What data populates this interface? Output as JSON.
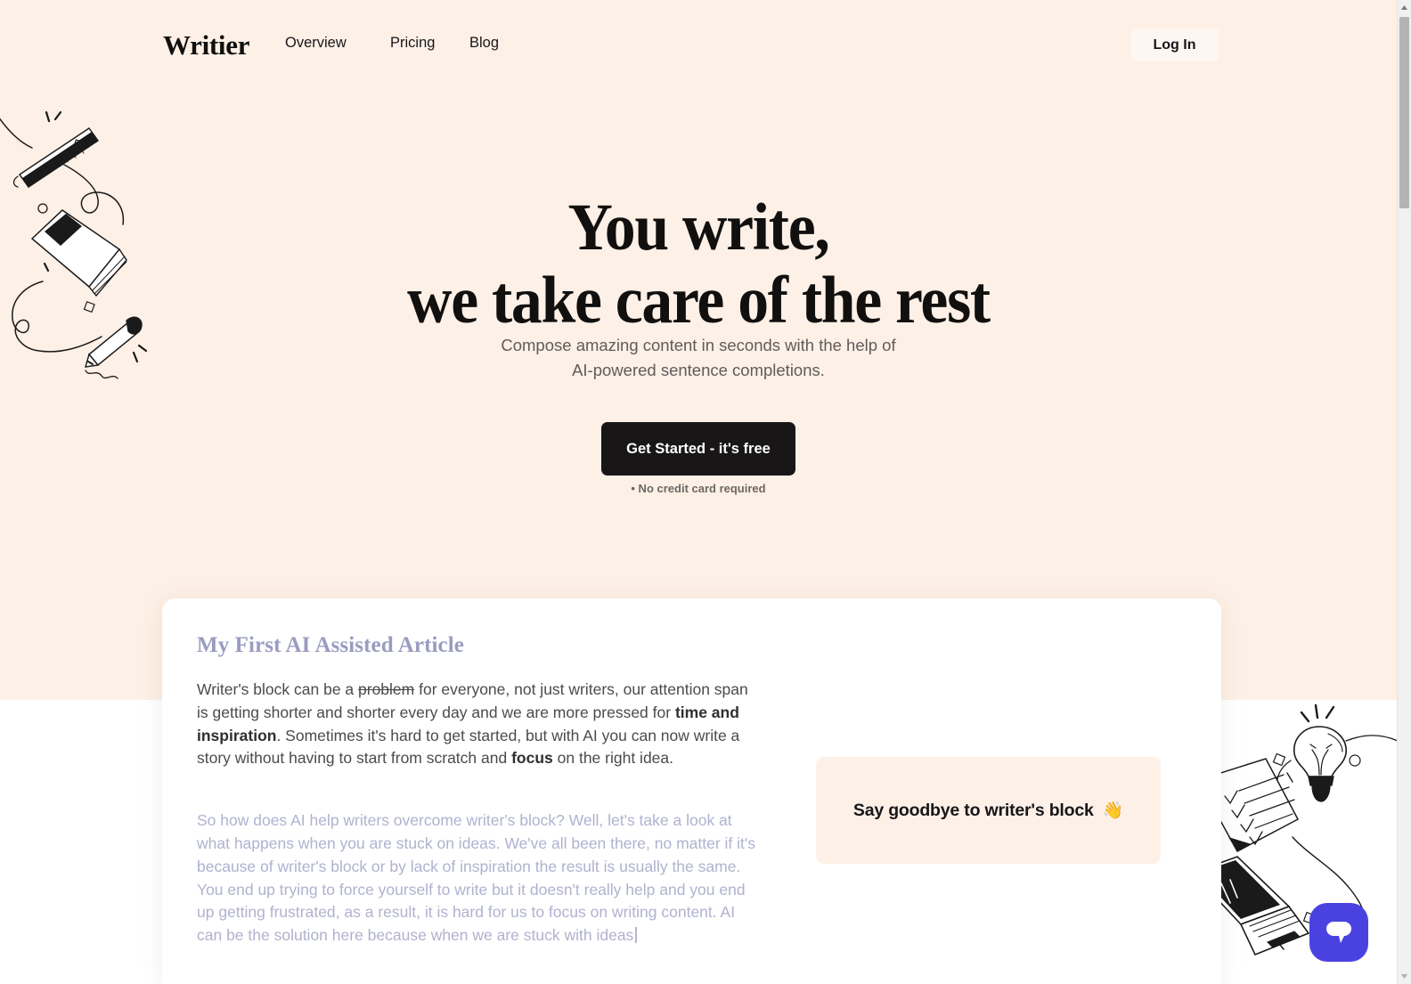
{
  "nav": {
    "brand": "Writier",
    "links": [
      {
        "label": "Overview"
      },
      {
        "label": "Pricing"
      },
      {
        "label": "Blog"
      }
    ],
    "login_label": "Log In"
  },
  "hero": {
    "title_line1": "You write,",
    "title_line2": "we take care of the rest",
    "subtitle_line1": "Compose amazing content in seconds with the help of",
    "subtitle_line2": "AI-powered sentence completions.",
    "cta_label": "Get Started - it's free",
    "cta_note": "• No credit card required"
  },
  "editor": {
    "title": "My First AI Assisted Article",
    "paragraph": {
      "seg1": "Writer's block can be a ",
      "strike": "problem",
      "seg2": " for everyone, not just writers, our attention span is getting shorter and shorter every day and we are more pressed for ",
      "bold1": "time and inspiration",
      "seg3": ". Sometimes it's hard to get started, but with AI you can now write a story without having to start from scratch and ",
      "bold2": "focus",
      "seg4": " on the right idea."
    },
    "ghost_paragraph": "So how does AI help writers overcome writer's block? Well, let's take a look at what happens when you are stuck on ideas. We've all been there, no matter if it's because of writer's block or by lack of inspiration the result is usually the same. You end up trying to force yourself to write but it doesn't really help and you end up getting frustrated, as a result, it is hard for us to focus on writing content. AI can be the solution here because when we are stuck with ideas",
    "callout_text": "Say goodbye to writer's block",
    "callout_emoji": "👋"
  },
  "widgets": {
    "chat_icon": "chat-bubble-icon"
  },
  "colors": {
    "cream": "#fdf0e6",
    "ink": "#11100f",
    "ghost_text": "#b0b2cf",
    "title_purple": "#9a9cc0",
    "chat_purple": "#4a42e0",
    "callout_bg": "#fdf1e7"
  }
}
